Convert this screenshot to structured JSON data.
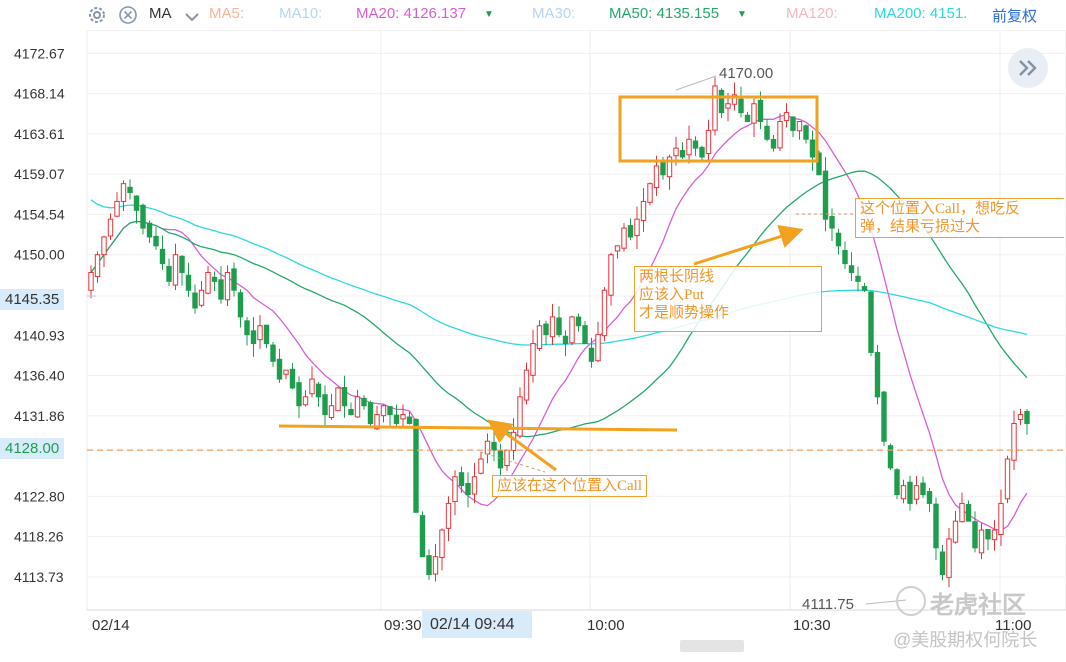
{
  "toolbar": {
    "ma_label": "MA",
    "adj_label": "前复权",
    "ma_items": [
      {
        "label": "MA5:",
        "value": "",
        "color": "#f7b593"
      },
      {
        "label": "MA10:",
        "value": "",
        "color": "#b9d4f3"
      },
      {
        "label": "MA20:",
        "value": "4126.137",
        "color": "#d85fd2"
      },
      {
        "label": "MA30:",
        "value": "",
        "color": "#b9d4f3"
      },
      {
        "label": "MA50:",
        "value": "4135.155",
        "color": "#26a86b"
      },
      {
        "label": "MA120:",
        "value": "",
        "color": "#f5b8bc"
      },
      {
        "label": "MA200:",
        "value": "4151.",
        "color": "#2fd8dc"
      }
    ]
  },
  "chart_data": {
    "type": "candlestick",
    "y_ticks": [
      "4172.67",
      "4168.14",
      "4163.61",
      "4159.07",
      "4154.54",
      "4150.00",
      "4145.35",
      "4140.93",
      "4136.40",
      "4131.86",
      "4128.00",
      "4122.80",
      "4118.26",
      "4113.73"
    ],
    "highlighted_price": "4145.35",
    "reference_price": "4128.00",
    "ylim": [
      4110.0,
      4175.3
    ],
    "x_ticks": [
      "02/14",
      "09:30",
      "10:00",
      "10:30",
      "11:00"
    ],
    "crosshair_time": "02/14 09:44",
    "high_label": "4170.00",
    "low_label": "4111.75",
    "up_color": "#e3343b",
    "down_color": "#1f9d4e",
    "annotations": [
      {
        "lines": [
          "应该在这个位置入Call"
        ]
      },
      {
        "lines": [
          "两根长阴线",
          "应该入Put",
          "才是顺势操作"
        ]
      },
      {
        "lines": [
          "这个位置入Call，想吃反",
          "弹，结果亏损过大"
        ]
      }
    ]
  },
  "watermark": {
    "brand": "老虎社区",
    "handle": "@美股期权何院长"
  }
}
